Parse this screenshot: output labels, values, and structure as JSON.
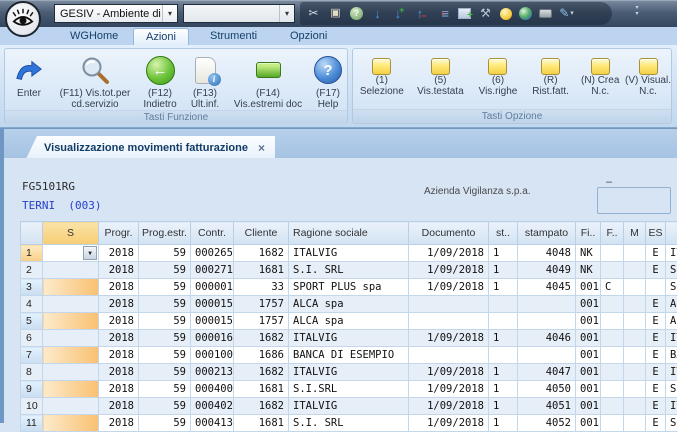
{
  "titlebar": {
    "app_selector": "GESIV - Ambiente di",
    "free_selector": "",
    "quick_icons": [
      "cut",
      "paste",
      "help",
      "move-down",
      "add-down",
      "remove-up",
      "list",
      "new-window",
      "tools",
      "lightbulb",
      "globe",
      "print",
      "edit",
      "more"
    ]
  },
  "ribbon": {
    "tabs": [
      {
        "label": "WGHome",
        "active": false
      },
      {
        "label": "Azioni",
        "active": true
      },
      {
        "label": "Strumenti",
        "active": false
      },
      {
        "label": "Opzioni",
        "active": false
      }
    ],
    "groups": [
      {
        "title": "Tasti Funzione",
        "buttons": [
          {
            "line1": "Enter",
            "line2": "",
            "icon": "enter-arrow"
          },
          {
            "line1": "(F11) Vis.tot.per",
            "line2": "cd.servizio",
            "icon": "magnifier"
          },
          {
            "line1": "(F12)",
            "line2": "Indietro",
            "icon": "back-arrow"
          },
          {
            "line1": "(F13)",
            "line2": "Ult.inf.",
            "icon": "scroll-info"
          },
          {
            "line1": "(F14)",
            "line2": "Vis.estremi doc",
            "icon": "green-button"
          },
          {
            "line1": "(F17)",
            "line2": "Help",
            "icon": "help-question"
          }
        ]
      },
      {
        "title": "Tasti Opzione",
        "buttons": [
          {
            "line1": "(1)",
            "line2": "Selezione"
          },
          {
            "line1": "(5)",
            "line2": "Vis.testata"
          },
          {
            "line1": "(6)",
            "line2": "Vis.righe"
          },
          {
            "line1": "(R)",
            "line2": "Rist.fatt."
          },
          {
            "line1": "(N) Crea",
            "line2": "N.c."
          },
          {
            "line1": "(V) Visual.",
            "line2": "N.c."
          }
        ]
      }
    ]
  },
  "document_tab": {
    "label": "Visualizzazione movimenti fatturazione",
    "close": "×"
  },
  "content": {
    "code": "FG5101RG",
    "branch": "TERNI  (003)",
    "company": "Azienda Vigilanza s.p.a.",
    "collapse_dash": "–"
  },
  "table": {
    "columns": [
      "",
      "S",
      "Progr.",
      "Prog.estr.",
      "Contr.",
      "Cliente",
      "Ragione sociale",
      "Documento",
      "st..",
      "stampato",
      "Fi..",
      "F..",
      "M",
      "ES",
      ""
    ],
    "column_keys": [
      "n",
      "s",
      "progr",
      "prog_estr",
      "contr",
      "cliente",
      "ragione",
      "documento",
      "st",
      "stampato",
      "fi",
      "f",
      "m",
      "es",
      "tail"
    ],
    "rows": [
      {
        "n": "1",
        "s": "",
        "progr": "2018",
        "prog_estr": "59",
        "contr": "000265",
        "cliente": "1682",
        "ragione": "ITALVIG",
        "documento": "1/09/2018",
        "st": "1",
        "stampato": "4048",
        "fi": "NK",
        "f": "",
        "m": "",
        "es": "E",
        "tail": "ITALVIG"
      },
      {
        "n": "2",
        "s": "",
        "progr": "2018",
        "prog_estr": "59",
        "contr": "000271",
        "cliente": "1681",
        "ragione": "S.I. SRL",
        "documento": "1/09/2018",
        "st": "1",
        "stampato": "4049",
        "fi": "NK",
        "f": "",
        "m": "",
        "es": "E",
        "tail": "S.I. SRL"
      },
      {
        "n": "3",
        "s": "",
        "progr": "2018",
        "prog_estr": "59",
        "contr": "000001",
        "cliente": "33",
        "ragione": "SPORT PLUS spa",
        "documento": "1/09/2018",
        "st": "1",
        "stampato": "4045",
        "fi": "001",
        "f": "C",
        "m": "",
        "es": "",
        "tail": "SPORT PLUS spa"
      },
      {
        "n": "4",
        "s": "",
        "progr": "2018",
        "prog_estr": "59",
        "contr": "000015",
        "cliente": "1757",
        "ragione": "ALCA spa",
        "documento": "",
        "st": "",
        "stampato": "",
        "fi": "001",
        "f": "",
        "m": "",
        "es": "E",
        "tail": "ALCA spa"
      },
      {
        "n": "5",
        "s": "",
        "progr": "2018",
        "prog_estr": "59",
        "contr": "000015",
        "cliente": "1757",
        "ragione": "ALCA spa",
        "documento": "",
        "st": "",
        "stampato": "",
        "fi": "001",
        "f": "",
        "m": "",
        "es": "E",
        "tail": "ALCA spa"
      },
      {
        "n": "6",
        "s": "",
        "progr": "2018",
        "prog_estr": "59",
        "contr": "000016",
        "cliente": "1682",
        "ragione": "ITALVIG",
        "documento": "1/09/2018",
        "st": "1",
        "stampato": "4046",
        "fi": "001",
        "f": "",
        "m": "",
        "es": "E",
        "tail": "ITALVIG"
      },
      {
        "n": "7",
        "s": "",
        "progr": "2018",
        "prog_estr": "59",
        "contr": "000100",
        "cliente": "1686",
        "ragione": "BANCA DI ESEMPIO",
        "documento": "",
        "st": "",
        "stampato": "",
        "fi": "001",
        "f": "",
        "m": "",
        "es": "E",
        "tail": "BANCA DI ESEMPIO"
      },
      {
        "n": "8",
        "s": "",
        "progr": "2018",
        "prog_estr": "59",
        "contr": "000213",
        "cliente": "1682",
        "ragione": "ITALVIG",
        "documento": "1/09/2018",
        "st": "1",
        "stampato": "4047",
        "fi": "001",
        "f": "",
        "m": "",
        "es": "E",
        "tail": "ITALVIG"
      },
      {
        "n": "9",
        "s": "",
        "progr": "2018",
        "prog_estr": "59",
        "contr": "000400",
        "cliente": "1681",
        "ragione": "S.I.SRL",
        "documento": "1/09/2018",
        "st": "1",
        "stampato": "4050",
        "fi": "001",
        "f": "",
        "m": "",
        "es": "E",
        "tail": "S.I.SRL"
      },
      {
        "n": "10",
        "s": "",
        "progr": "2018",
        "prog_estr": "59",
        "contr": "000402",
        "cliente": "1682",
        "ragione": "ITALVIG",
        "documento": "1/09/2018",
        "st": "1",
        "stampato": "4051",
        "fi": "001",
        "f": "",
        "m": "",
        "es": "E",
        "tail": "ITALVIG"
      },
      {
        "n": "11",
        "s": "",
        "progr": "2018",
        "prog_estr": "59",
        "contr": "000413",
        "cliente": "1681",
        "ragione": "S.I. SRL",
        "documento": "1/09/2018",
        "st": "1",
        "stampato": "4052",
        "fi": "001",
        "f": "",
        "m": "",
        "es": "E",
        "tail": "S.I. SRL"
      }
    ]
  },
  "colors": {
    "accent_amber": "#f6cd74",
    "selection_orange": "#f8c171",
    "ribbon_blue": "#cfe1f4",
    "titlebar": "#33465e"
  }
}
